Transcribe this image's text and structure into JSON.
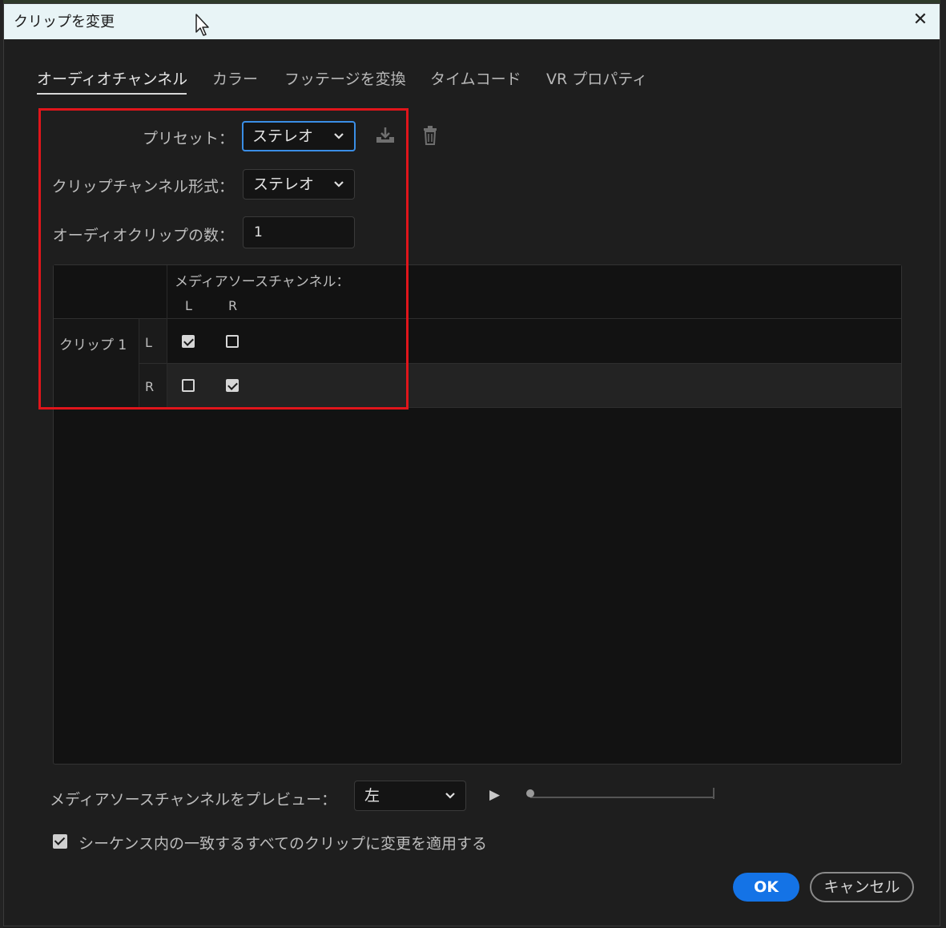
{
  "window": {
    "title": "クリップを変更"
  },
  "tabs": [
    {
      "label": "オーディオチャンネル",
      "active": true
    },
    {
      "label": "カラー",
      "active": false
    },
    {
      "label": "フッテージを変換",
      "active": false
    },
    {
      "label": "タイムコード",
      "active": false
    },
    {
      "label": "VR プロパティ",
      "active": false
    }
  ],
  "preset": {
    "label": "プリセット：",
    "value": "ステレオ"
  },
  "clip_channel_format": {
    "label": "クリップチャンネル形式：",
    "value": "ステレオ"
  },
  "audio_clip_count": {
    "label": "オーディオクリップの数：",
    "value": "1"
  },
  "matrix": {
    "header": "メディアソースチャンネル：",
    "columns": [
      "L",
      "R"
    ],
    "clip_label": "クリップ 1",
    "rows": [
      {
        "channel": "L",
        "checked": [
          true,
          false
        ]
      },
      {
        "channel": "R",
        "checked": [
          false,
          true
        ]
      }
    ]
  },
  "preview": {
    "label": "メディアソースチャンネルをプレビュー：",
    "value": "左",
    "position": 0
  },
  "apply_all": {
    "label": "シーケンス内の一致するすべてのクリップに変更を適用する",
    "checked": true
  },
  "buttons": {
    "ok": "OK",
    "cancel": "キャンセル"
  },
  "colors": {
    "accent": "#1473e6",
    "highlight_box": "#e0151b",
    "titlebar": "#e8f4f6"
  }
}
